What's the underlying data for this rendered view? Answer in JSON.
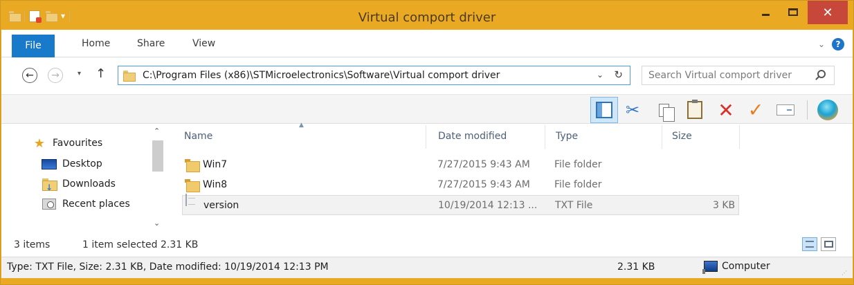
{
  "window": {
    "title": "Virtual comport driver",
    "close_glyph": "✕"
  },
  "quick_access": {
    "dropdown_glyph": "▾"
  },
  "ribbon": {
    "tabs": [
      {
        "label": "File",
        "active": true
      },
      {
        "label": "Home"
      },
      {
        "label": "Share"
      },
      {
        "label": "View"
      }
    ],
    "help_glyph": "?",
    "expand_glyph": "⌄"
  },
  "address": {
    "back_glyph": "←",
    "forward_glyph": "→",
    "recent_glyph": "▾",
    "up_glyph": "↑",
    "path": "C:\\Program Files (x86)\\STMicroelectronics\\Software\\Virtual comport driver",
    "dropdown_glyph": "⌄",
    "refresh_glyph": "↻"
  },
  "search": {
    "placeholder": "Search Virtual comport driver"
  },
  "toolbar": {
    "cut_glyph": "✂",
    "delete_glyph": "✕",
    "check_glyph": "✓"
  },
  "navigation": {
    "favourites": "Favourites",
    "items": [
      {
        "label": "Desktop"
      },
      {
        "label": "Downloads"
      },
      {
        "label": "Recent places"
      }
    ],
    "scroll_up_glyph": "⌃",
    "scroll_down_glyph": "⌄"
  },
  "columns": {
    "name": "Name",
    "date": "Date modified",
    "type": "Type",
    "size": "Size",
    "sort_glyph": "▲"
  },
  "files": [
    {
      "name": "Win7",
      "date": "7/27/2015 9:43 AM",
      "type": "File folder",
      "size": "",
      "kind": "folder"
    },
    {
      "name": "Win8",
      "date": "7/27/2015 9:43 AM",
      "type": "File folder",
      "size": "",
      "kind": "folder"
    },
    {
      "name": "version",
      "date": "10/19/2014 12:13 ...",
      "type": "TXT File",
      "size": "3 KB",
      "kind": "file",
      "selected": true
    }
  ],
  "status": {
    "item_count": "3 items",
    "selection": "1 item selected  2.31 KB"
  },
  "details": {
    "info": "Type: TXT File, Size: 2.31 KB, Date modified: 10/19/2014 12:13 PM",
    "size": "2.31 KB",
    "location": "Computer"
  },
  "colors": {
    "title_bar": "#eaa922",
    "accent": "#1979ca",
    "close": "#c7473a"
  }
}
